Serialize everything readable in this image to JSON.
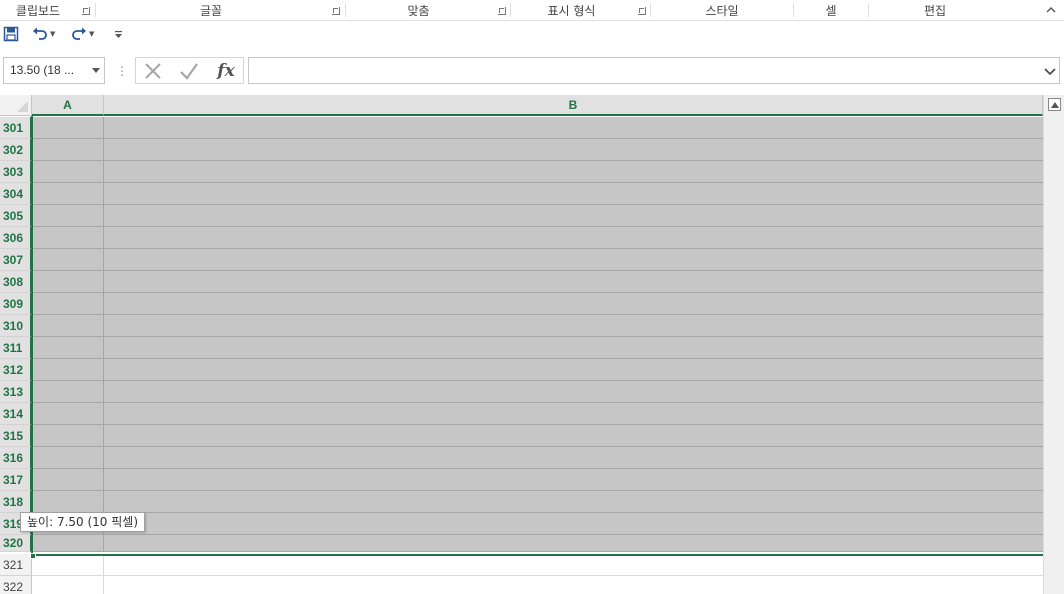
{
  "ribbon": {
    "groups": [
      {
        "label": "클립보드"
      },
      {
        "label": "글꼴"
      },
      {
        "label": "맞춤"
      },
      {
        "label": "표시 형식"
      },
      {
        "label": "스타일"
      },
      {
        "label": "셀"
      },
      {
        "label": "편집"
      }
    ],
    "collapse_icon": "chevron-up-icon"
  },
  "qat": {
    "icons": [
      "save-icon",
      "undo-icon",
      "redo-icon",
      "customize-qat-icon"
    ]
  },
  "formula_bar": {
    "name_box_value": "13.50 (18 ...",
    "formula_value": "",
    "icons": [
      "cancel-icon",
      "enter-icon",
      "insert-function-icon",
      "expand-icon"
    ]
  },
  "sheet": {
    "columns": [
      {
        "label": "A"
      },
      {
        "label": "B"
      }
    ],
    "selected_rows": [
      "301",
      "302",
      "303",
      "304",
      "305",
      "306",
      "307",
      "308",
      "309",
      "310",
      "311",
      "312",
      "313",
      "314",
      "315",
      "316",
      "317",
      "318",
      "319",
      "320"
    ],
    "unselected_rows": [
      "321",
      "322"
    ],
    "tooltip": "높이: 7.50 (10 픽셀)",
    "selection_color": "#217346"
  }
}
